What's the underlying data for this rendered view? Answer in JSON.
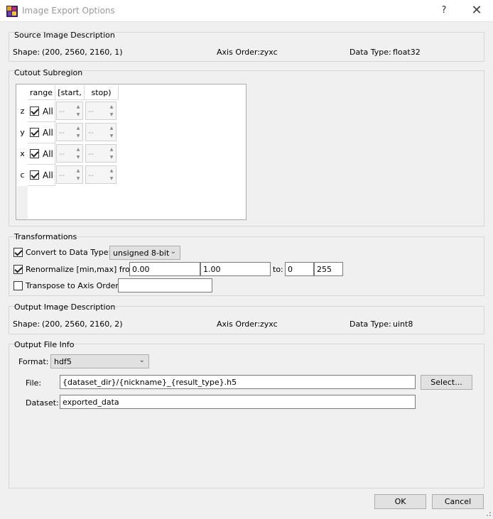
{
  "window": {
    "title": "Image Export Options",
    "help": "?",
    "close": "✕"
  },
  "source": {
    "title": "Source Image Description",
    "shape_label": "Shape:",
    "shape_value": "(200, 2560, 2160, 1)",
    "axis_label": "Axis Order:",
    "axis_value": "zyxc",
    "dtype_label": "Data Type:",
    "dtype_value": "float32"
  },
  "cutout": {
    "title": "Cutout Subregion",
    "headers": [
      "range",
      "[start,",
      "stop)"
    ],
    "rows": [
      {
        "axis": "z",
        "all_label": "All",
        "all_checked": true,
        "start": "--",
        "stop": "--"
      },
      {
        "axis": "y",
        "all_label": "All",
        "all_checked": true,
        "start": "--",
        "stop": "--"
      },
      {
        "axis": "x",
        "all_label": "All",
        "all_checked": true,
        "start": "--",
        "stop": "--"
      },
      {
        "axis": "c",
        "all_label": "All",
        "all_checked": true,
        "start": "--",
        "stop": "--"
      }
    ]
  },
  "transform": {
    "title": "Transformations",
    "convert_label": "Convert to Data Type:",
    "convert_checked": true,
    "convert_value": "unsigned 8-bit",
    "renorm_label": "Renormalize [min,max] from:",
    "renorm_checked": true,
    "renorm_from_min": "0.00",
    "renorm_from_max": "1.00",
    "renorm_to_label": "to:",
    "renorm_to_min": "0",
    "renorm_to_max": "255",
    "transpose_label": "Transpose to Axis Order:",
    "transpose_checked": false,
    "transpose_value": ""
  },
  "output_desc": {
    "title": "Output Image Description",
    "shape_label": "Shape:",
    "shape_value": "(200, 2560, 2160, 2)",
    "axis_label": "Axis Order:",
    "axis_value": "zyxc",
    "dtype_label": "Data Type:",
    "dtype_value": "uint8"
  },
  "output_file": {
    "title": "Output File Info",
    "format_label": "Format:",
    "format_value": "hdf5",
    "file_label": "File:",
    "file_value": "{dataset_dir}/{nickname}_{result_type}.h5",
    "select_label": "Select...",
    "dataset_label": "Dataset:",
    "dataset_value": "exported_data"
  },
  "buttons": {
    "ok": "OK",
    "cancel": "Cancel"
  },
  "colors": {
    "background": "#f0f0f0",
    "border": "#d6d6d6"
  }
}
